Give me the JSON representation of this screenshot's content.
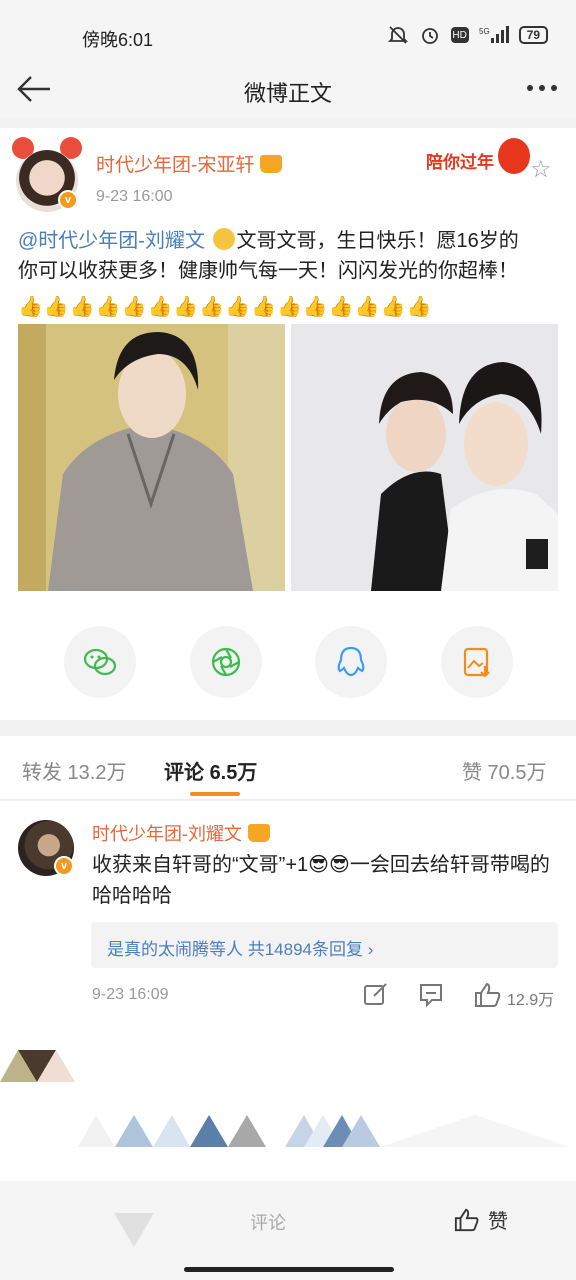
{
  "status_bar": {
    "time": "傍晚6:01",
    "network": "5G",
    "battery": "79",
    "hd": "HD"
  },
  "nav": {
    "title": "微博正文"
  },
  "post": {
    "author": "时代少年团-宋亚轩",
    "time": "9-23 16:00",
    "badge_text": "陪你过年",
    "mention": "@时代少年团-刘耀文",
    "text_line1": "文哥文哥，生日快乐！愿16岁的",
    "text_line2": "你可以收获更多！健康帅气每一天！闪闪发光的你超棒！",
    "thumbs": "👍👍👍👍👍👍👍👍👍👍👍👍👍👍👍👍",
    "icons": {
      "verified": "v-badge-icon",
      "crown": "crown-icon",
      "star": "star-icon"
    }
  },
  "share": [
    {
      "name": "wechat-icon",
      "color": "#3dbb4e"
    },
    {
      "name": "moments-icon",
      "color": "#3dbb4e"
    },
    {
      "name": "qq-icon",
      "color": "#3a9cf5"
    },
    {
      "name": "save-image-icon",
      "color": "#f28c1e"
    }
  ],
  "tabs": {
    "repost": "转发 13.2万",
    "comments_label": "评论",
    "comments_count": "6.5万",
    "likes": "赞 70.5万"
  },
  "comment": {
    "author": "时代少年团-刘耀文",
    "text": "收获来自轩哥的“文哥”+1😎😎一会回去给轩哥带喝的哈哈哈哈",
    "reply_summary": "是真的太闹腾等人  共14894条回复 ›",
    "time": "9-23 16:09",
    "like_count": "12.9万"
  },
  "bottom_bar": {
    "comment_placeholder": "评论",
    "like_label": "赞"
  },
  "colors": {
    "accent": "#f28c1e",
    "name": "#e8663a",
    "link": "#4a7fbf"
  }
}
